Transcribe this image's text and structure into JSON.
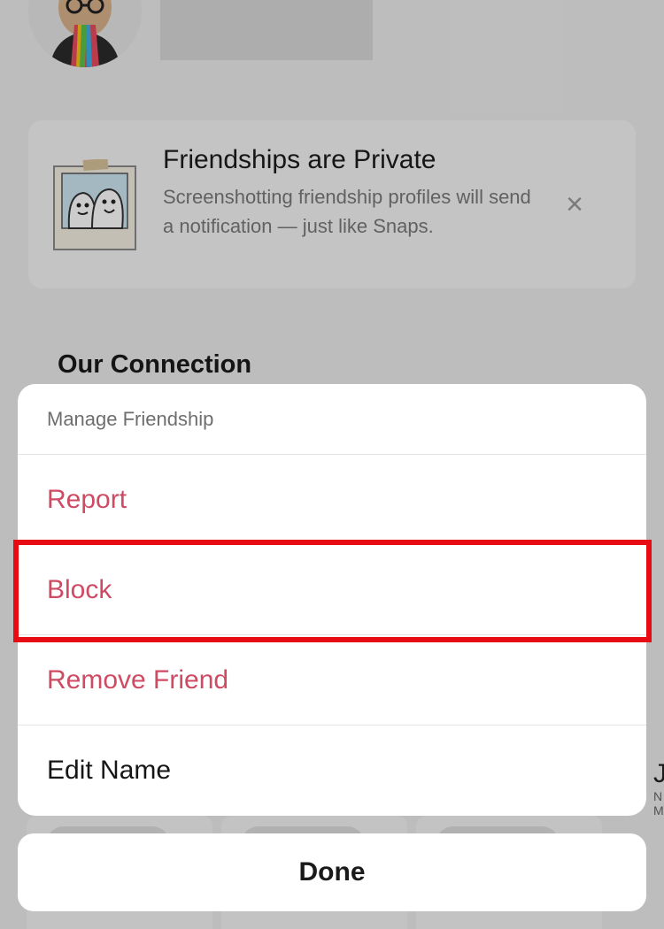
{
  "notice": {
    "title": "Friendships are Private",
    "body": "Screenshotting friendship profiles will send a notification — just like Snaps.",
    "dismiss_icon": "close-icon",
    "illustration_icon": "polaroid-ghosts-icon"
  },
  "section": {
    "heading": "Our Connection"
  },
  "sheet": {
    "header": "Manage Friendship",
    "actions": [
      {
        "label": "Report",
        "tone": "danger"
      },
      {
        "label": "Block",
        "tone": "danger",
        "highlighted": true
      },
      {
        "label": "Remove Friend",
        "tone": "danger"
      },
      {
        "label": "Edit Name",
        "tone": "normal"
      }
    ],
    "done_label": "Done"
  },
  "partial_edge": {
    "letter": "J",
    "sub": "N M"
  },
  "colors": {
    "danger": "#cf4a63",
    "highlight": "#e80c12",
    "sheet_bg": "#ffffff"
  }
}
